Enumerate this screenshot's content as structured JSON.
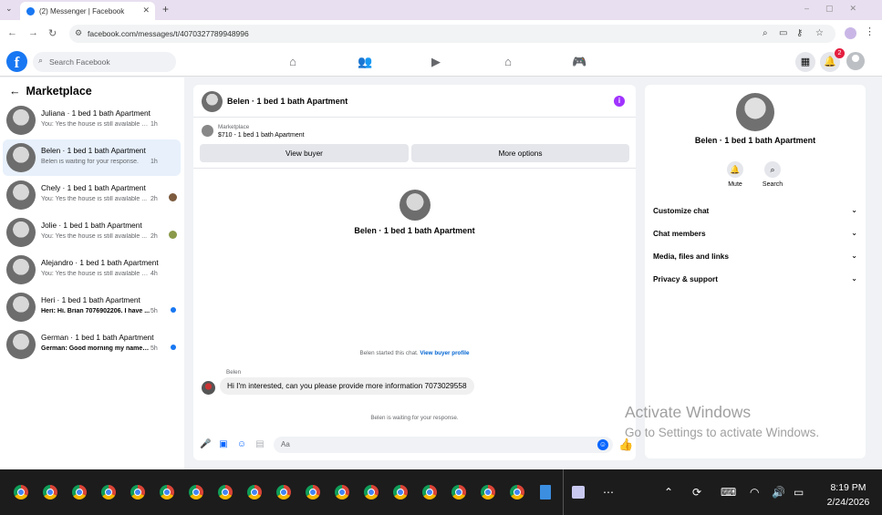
{
  "browser": {
    "tab_title": "(2) Messenger | Facebook",
    "url": "facebook.com/messages/t/4070327789948996"
  },
  "header": {
    "search_placeholder": "Search Facebook",
    "notif_count": "2"
  },
  "sidebar": {
    "title": "Marketplace",
    "conversations": [
      {
        "name": "Juliana · 1 bed 1 bath Apartment",
        "preview": "You: Yes the house is still available Se...",
        "time": "1h"
      },
      {
        "name": "Belen · 1 bed 1 bath Apartment",
        "preview": "Belen is waiting for your response.",
        "time": "1h"
      },
      {
        "name": "Chely · 1 bed 1 bath Apartment",
        "preview": "You: Yes the house is still available ...",
        "time": "2h"
      },
      {
        "name": "Jolie · 1 bed 1 bath Apartment",
        "preview": "You: Yes the house is still available ...",
        "time": "2h"
      },
      {
        "name": "Alejandro · 1 bed 1 bath Apartment",
        "preview": "You: Yes the house is still available Se...",
        "time": "4h"
      },
      {
        "name": "Heri · 1 bed 1 bath Apartment",
        "preview": "Heri: Hi. Brian 7076902206. I have ...",
        "time": "5h"
      },
      {
        "name": "German · 1 bed 1 bath Apartment",
        "preview": "German: Good morning my name i...",
        "time": "5h"
      }
    ]
  },
  "chat": {
    "title": "Belen · 1 bed 1 bath Apartment",
    "listing_label": "Marketplace",
    "listing_price": "$710 - 1 bed 1 bath Apartment",
    "view_buyer": "View buyer",
    "more_options": "More options",
    "center_name": "Belen · 1 bed 1 bath Apartment",
    "started_text": "Belen started this chat.",
    "view_profile": "View buyer profile",
    "sender": "Belen",
    "message": "Hi I'm interested, can you please provide more information 7073029558",
    "waiting": "Belen is waiting for your response.",
    "input_placeholder": "Aa"
  },
  "right": {
    "name": "Belen · 1 bed 1 bath Apartment",
    "mute": "Mute",
    "search": "Search",
    "rows": [
      "Customize chat",
      "Chat members",
      "Media, files and links",
      "Privacy & support"
    ]
  },
  "watermark": {
    "line1": "Activate Windows",
    "line2": "Go to Settings to activate Windows."
  },
  "taskbar": {
    "time": "8:19 PM",
    "date": "2/24/2026"
  },
  "colors": {
    "accent": "#1877f2",
    "messenger_blue": "#0866ff",
    "info_purple": "#a033ff"
  }
}
